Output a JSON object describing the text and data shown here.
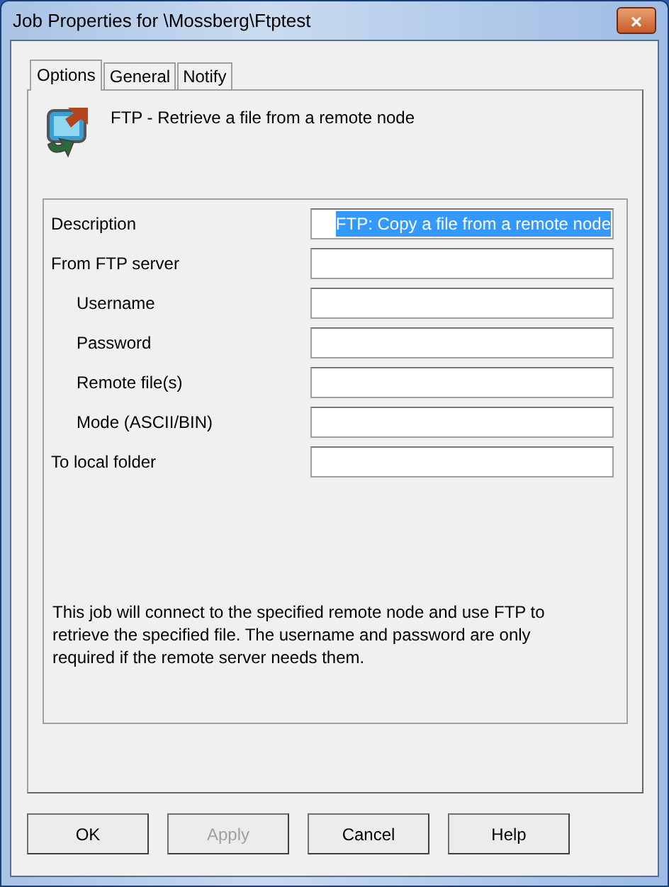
{
  "window": {
    "title": "Job Properties for \\Mossberg\\Ftptest",
    "close": "×"
  },
  "tabs": [
    {
      "label": "Options",
      "selected": true
    },
    {
      "label": "General",
      "selected": false
    },
    {
      "label": "Notify",
      "selected": false
    }
  ],
  "heading": "FTP - Retrieve a file from a remote node",
  "fields": [
    {
      "label": "Description",
      "value": "FTP: Copy a file from a remote node",
      "value_selected": true
    },
    {
      "label": "From FTP server",
      "children": [
        {
          "label": "Username"
        },
        {
          "label": "Password"
        },
        {
          "label": "Remote file(s)"
        },
        {
          "label": "Mode (ASCII/BIN)"
        }
      ]
    },
    {
      "label": "To local folder"
    }
  ],
  "help_text": "This job will connect to the specified remote node and use FTP to retrieve the specified file.  The username and password are only required if the remote server needs them.",
  "buttons": [
    {
      "label": "OK",
      "disabled": false
    },
    {
      "label": "Apply",
      "disabled": true
    },
    {
      "label": "Cancel",
      "disabled": false
    },
    {
      "label": "Help",
      "disabled": false
    }
  ]
}
